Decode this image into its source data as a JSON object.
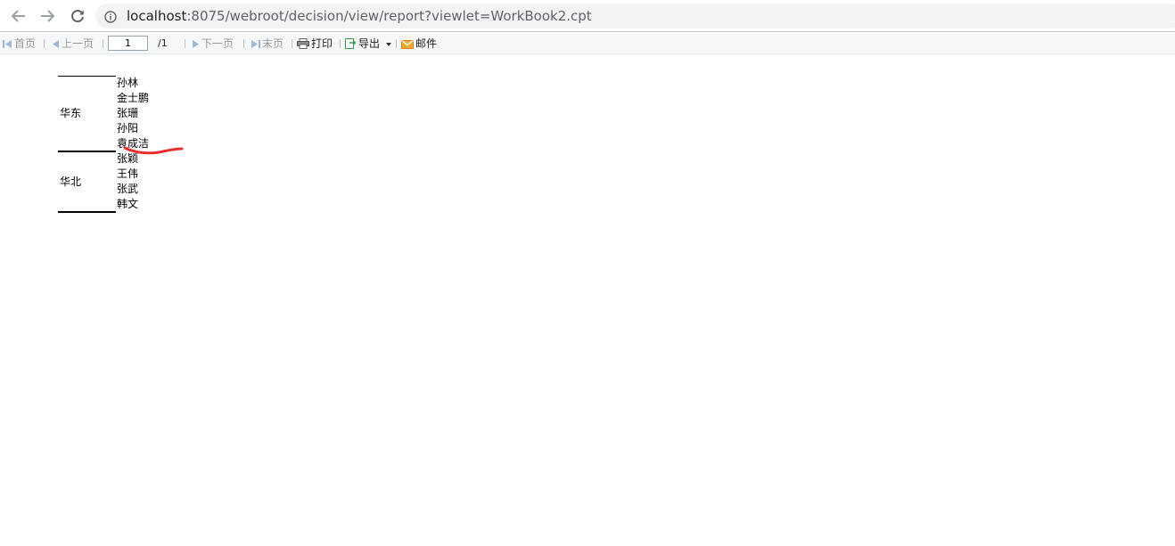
{
  "browser": {
    "url_host": "localhost",
    "url_rest": ":8075/webroot/decision/view/report?viewlet=WorkBook2.cpt"
  },
  "toolbar": {
    "first": "首页",
    "prev": "上一页",
    "page_value": "1",
    "page_total": "/1",
    "next": "下一页",
    "last": "末页",
    "print": "打印",
    "export": "导出",
    "email": "邮件"
  },
  "report": {
    "groups": [
      {
        "region": "华东",
        "names": [
          "孙林",
          "金士鹏",
          "张珊",
          "孙阳",
          "袁成洁"
        ]
      },
      {
        "region": "华北",
        "names": [
          "张颖",
          "王伟",
          "张武",
          "韩文"
        ]
      }
    ]
  },
  "colors": {
    "annotation_stroke": "#e8302f",
    "email_icon": "#f0a93a",
    "export_icon": "#3a9a4a",
    "nav_arrow_disabled": "#9fb8d8"
  }
}
